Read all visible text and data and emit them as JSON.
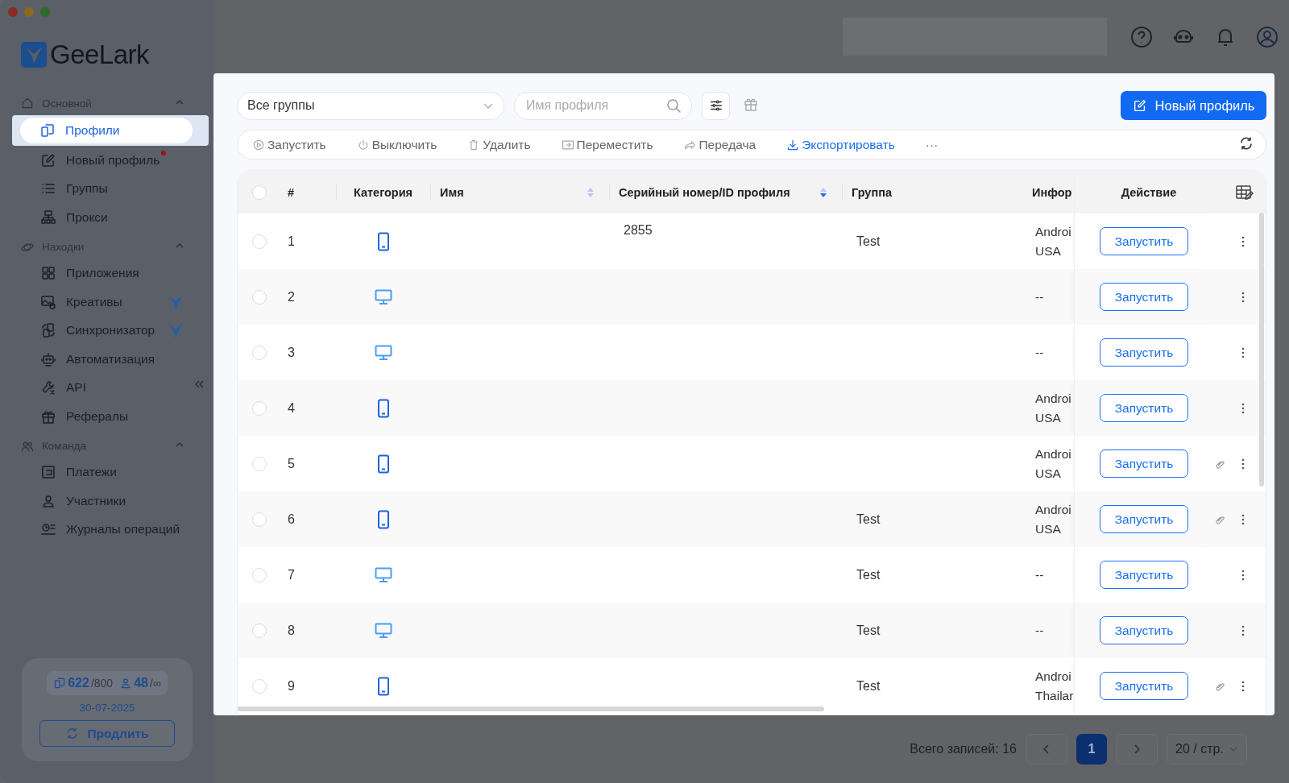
{
  "sidebar": {
    "logo": "GeeLark",
    "sections": [
      {
        "title": "Основной",
        "expanded": true,
        "items": [
          {
            "label": "Профили",
            "selected": true
          },
          {
            "label": "Новый профиль",
            "selected": false,
            "dot": true
          },
          {
            "label": "Группы",
            "selected": false
          },
          {
            "label": "Прокси",
            "selected": false
          }
        ]
      },
      {
        "title": "Находки",
        "expanded": true,
        "items": [
          {
            "label": "Приложения",
            "selected": false
          },
          {
            "label": "Креативы",
            "selected": false,
            "badge": true
          },
          {
            "label": "Синхронизатор",
            "selected": false,
            "badge": true
          },
          {
            "label": "Автоматизация",
            "selected": false
          },
          {
            "label": "API",
            "selected": false
          },
          {
            "label": "Рефералы",
            "selected": false
          }
        ]
      },
      {
        "title": "Команда",
        "expanded": true,
        "items": [
          {
            "label": "Платежи",
            "selected": false
          },
          {
            "label": "Участники",
            "selected": false
          },
          {
            "label": "Журналы операций",
            "selected": false
          }
        ]
      }
    ],
    "plan": {
      "profiles_used": "622",
      "profiles_limit": "/800",
      "members_used": "48",
      "members_limit": "/∞",
      "expires": "30-07-2025",
      "renew_button": "Продлить"
    }
  },
  "toolbar": {
    "group_select": "Все группы",
    "search": {
      "placeholder": "Имя профиля"
    },
    "new_profile_button": "Новый профиль"
  },
  "actions": [
    {
      "label": "Запустить",
      "accent": false
    },
    {
      "label": "Выключить",
      "accent": false
    },
    {
      "label": "Удалить",
      "accent": false
    },
    {
      "label": "Переместить",
      "accent": false
    },
    {
      "label": "Передача",
      "accent": false
    },
    {
      "label": "Экспортировать",
      "accent": true
    },
    {
      "label": "···",
      "accent": false
    }
  ],
  "table": {
    "all_checked": false,
    "columns": [
      {
        "label": "#"
      },
      {
        "label": "Категория"
      },
      {
        "label": "Имя",
        "sorted": false
      },
      {
        "label": "Серийный номер/ID профиля",
        "sorted": true
      },
      {
        "label": "Группа"
      },
      {
        "label": "Инфор"
      },
      {
        "label": "Действие"
      }
    ],
    "rows": [
      {
        "number": "1",
        "checked": false,
        "kind": "phone",
        "serial": "2855",
        "group": "Test",
        "info": [
          "Androi",
          "USA"
        ],
        "action": "Запустить",
        "link": false
      },
      {
        "number": "2",
        "checked": false,
        "kind": "desktop",
        "info": [
          "--"
        ],
        "action": "Запустить",
        "link": false
      },
      {
        "number": "3",
        "checked": false,
        "kind": "desktop",
        "info": [
          "--"
        ],
        "action": "Запустить",
        "link": false
      },
      {
        "number": "4",
        "checked": false,
        "kind": "phone",
        "info": [
          "Androi",
          "USA"
        ],
        "action": "Запустить",
        "link": false
      },
      {
        "number": "5",
        "checked": false,
        "kind": "phone",
        "info": [
          "Androi",
          "USA"
        ],
        "action": "Запустить",
        "link": true
      },
      {
        "number": "6",
        "checked": false,
        "kind": "phone",
        "group": "Test",
        "info": [
          "Androi",
          "USA"
        ],
        "action": "Запустить",
        "link": true
      },
      {
        "number": "7",
        "checked": false,
        "kind": "desktop",
        "group": "Test",
        "info": [
          "--"
        ],
        "action": "Запустить",
        "link": false
      },
      {
        "number": "8",
        "checked": false,
        "kind": "desktop",
        "group": "Test",
        "info": [
          "--"
        ],
        "action": "Запустить",
        "link": false
      },
      {
        "number": "9",
        "checked": false,
        "kind": "phone",
        "group": "Test",
        "info": [
          "Androi",
          "Thailar"
        ],
        "action": "Запустить",
        "link": true
      }
    ]
  },
  "pagination": {
    "total": "Всего записей: 16",
    "pages": [
      {
        "label": "1",
        "selected": true
      }
    ],
    "page_size": "20 / стр."
  }
}
